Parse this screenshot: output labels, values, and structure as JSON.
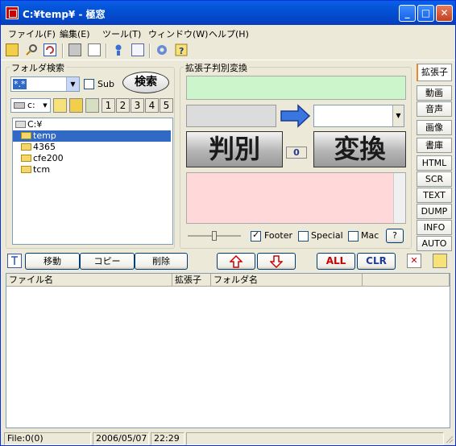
{
  "window": {
    "title": "C:¥temp¥ - 極窓"
  },
  "menu": [
    "ファイル(F)",
    "編集(E)",
    "ツール(T)",
    "ウィンドウ(W)",
    "ヘルプ(H)"
  ],
  "search_panel": {
    "title": "フォルダ検索",
    "pattern_value": "*.*",
    "sub_label": "Sub",
    "search_button": "検索",
    "drive_value": "c:",
    "number_buttons": [
      "1",
      "2",
      "3",
      "4",
      "5"
    ]
  },
  "tree": [
    "C:¥",
    "temp",
    "4365",
    "cfe200",
    "tcm"
  ],
  "ext_panel": {
    "title": "拡張子判別変換",
    "judge_button": "判別",
    "convert_button": "変換",
    "count": "0",
    "footer_label": "Footer",
    "special_label": "Special",
    "mac_label": "Mac",
    "help_button": "?"
  },
  "right_tabs": [
    "拡張子",
    "動画",
    "音声",
    "画像",
    "書庫",
    "HTML",
    "SCR",
    "TEXT",
    "DUMP",
    "INFO",
    "AUTO"
  ],
  "action_bar": {
    "move": "移動",
    "copy": "コピー",
    "delete": "削除",
    "all": "ALL",
    "clr": "CLR"
  },
  "list": {
    "columns": [
      "ファイル名",
      "拡張子",
      "フォルダ名"
    ]
  },
  "status": {
    "files": "File:0(0)",
    "date": "2006/05/07",
    "time": "22:29"
  },
  "colors": {
    "title_bar": "#0451d4",
    "green_box": "#ccf5cc",
    "pink_box": "#ffd9d9",
    "arrow_blue": "#3a76e0",
    "red_text": "#cc0000",
    "blue_text": "#1f3a9a"
  }
}
